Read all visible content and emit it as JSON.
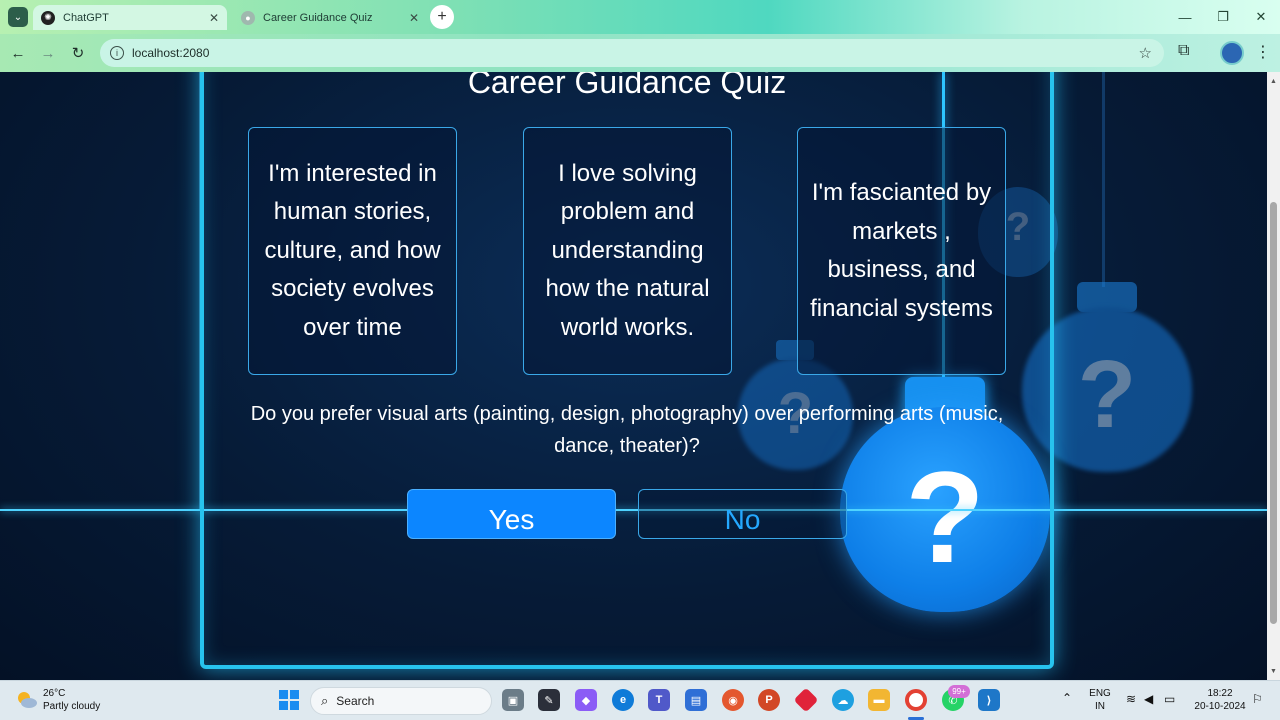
{
  "browser": {
    "tabs": [
      {
        "label": "ChatGPT",
        "active": true
      },
      {
        "label": "Career Guidance Quiz",
        "active": false
      }
    ],
    "url": "localhost:2080"
  },
  "quiz": {
    "title": "Career Guidance Quiz",
    "cards": [
      "I'm interested in human stories, culture, and how society evolves over time",
      "I love solving problem and understanding how the natural world works.",
      "I'm fascianted by markets , business, and financial systems"
    ],
    "question": "Do you prefer visual arts (painting, design, photography) over performing arts (music, dance, theater)?",
    "yes_label": "Yes",
    "no_label": "No",
    "question_mark": "?"
  },
  "taskbar": {
    "weather_temp": "26°C",
    "weather_desc": "Partly cloudy",
    "search_label": "Search",
    "notification_badge": "99+",
    "lang_top": "ENG",
    "lang_bottom": "IN",
    "time": "18:22",
    "date": "20-10-2024"
  },
  "colors": {
    "accent": "#0c86ff",
    "neon": "#27c3ee"
  }
}
